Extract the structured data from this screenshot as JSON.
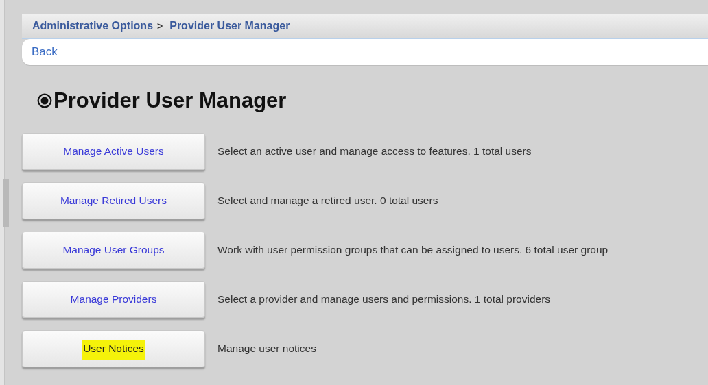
{
  "breadcrumb": [
    {
      "label": "Administrative Options"
    },
    {
      "label": "Provider User Manager"
    }
  ],
  "breadcrumb_separator": ">",
  "back_link": "Back",
  "heading": "Provider User Manager",
  "options": [
    {
      "button": "Manage Active Users",
      "description": "Select an active user and manage access to features. 1 total users",
      "highlighted": false
    },
    {
      "button": "Manage Retired Users",
      "description": "Select and manage a retired user. 0 total users",
      "highlighted": false
    },
    {
      "button": "Manage User Groups",
      "description": "Work with user permission groups that can be assigned to users. 6 total user group",
      "highlighted": false
    },
    {
      "button": "Manage Providers",
      "description": "Select a provider and manage users and permissions. 1 total providers",
      "highlighted": false
    },
    {
      "button": "User Notices",
      "description": "Manage user notices",
      "highlighted": true
    }
  ]
}
